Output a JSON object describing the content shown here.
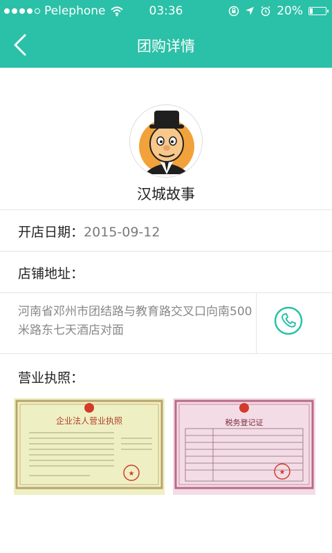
{
  "status_bar": {
    "carrier": "Pelephone",
    "time": "03:36",
    "battery": "20%",
    "battery_level": 0.2
  },
  "nav": {
    "title": "团购详情"
  },
  "store": {
    "name": "汉城故事",
    "open_date_label": "开店日期：",
    "open_date": "2015-09-12",
    "address_label": "店铺地址：",
    "address": "河南省邓州市团结路与教育路交叉口向南500米路东七天酒店对面",
    "license_label": "营业执照："
  },
  "licenses": [
    {
      "icon": "business-license-image",
      "title": "企业法人营业执照"
    },
    {
      "icon": "tax-registration-image",
      "title": "税务登记证"
    }
  ],
  "colors": {
    "accent": "#2bc0a8",
    "divider": "#e4e4e4"
  }
}
